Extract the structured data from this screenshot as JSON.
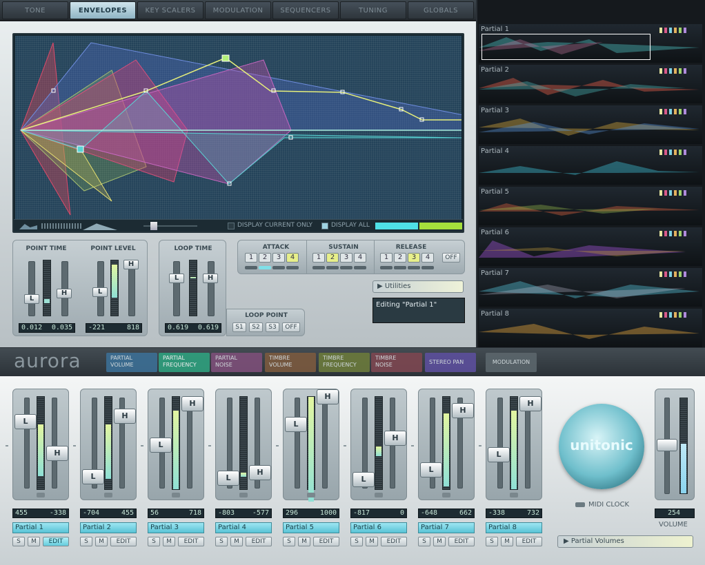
{
  "top_tabs": [
    {
      "label": "TONE",
      "active": false
    },
    {
      "label": "ENVELOPES",
      "active": true
    },
    {
      "label": "KEY SCALERS",
      "active": false
    },
    {
      "label": "MODULATION",
      "active": false
    },
    {
      "label": "SEQUENCERS",
      "active": false
    },
    {
      "label": "TUNING",
      "active": false
    },
    {
      "label": "GLOBALS",
      "active": false
    }
  ],
  "envelope_display": {
    "display_current_only": "DISPLAY CURRENT ONLY",
    "display_all": "DISPLAY ALL"
  },
  "point_controls": {
    "point_time_label": "POINT TIME",
    "point_level_label": "POINT LEVEL",
    "point_time_values": [
      "0.012",
      "0.035"
    ],
    "point_level_values": [
      "-221",
      "818"
    ],
    "loop_time_label": "LOOP TIME",
    "loop_time_values": [
      "0.619",
      "0.619"
    ],
    "knob_low": "L",
    "knob_high": "H"
  },
  "stages": {
    "attack_label": "ATTACK",
    "sustain_label": "SUSTAIN",
    "release_label": "RELEASE",
    "attack": {
      "options": [
        "1",
        "2",
        "3",
        "4"
      ],
      "selected": "4"
    },
    "sustain": {
      "options": [
        "1",
        "2",
        "3",
        "4"
      ],
      "selected": "2"
    },
    "release": {
      "options": [
        "1",
        "2",
        "3",
        "4"
      ],
      "selected": "3"
    },
    "off_label": "OFF"
  },
  "loop_point": {
    "label": "LOOP POINT",
    "options": [
      "S1",
      "S2",
      "S3",
      "OFF"
    ]
  },
  "utilities": {
    "label": "Utilities",
    "editing_text": "Editing \"Partial 1\""
  },
  "partials_panel": [
    {
      "label": "Partial 1"
    },
    {
      "label": "Partial 2"
    },
    {
      "label": "Partial 3"
    },
    {
      "label": "Partial 4"
    },
    {
      "label": "Partial 5"
    },
    {
      "label": "Partial 6"
    },
    {
      "label": "Partial 7"
    },
    {
      "label": "Partial 8"
    }
  ],
  "logo": "aurora",
  "mod_tabs": [
    {
      "line1": "PARTIAL",
      "line2": "VOLUME",
      "color": "#3c6f95"
    },
    {
      "line1": "PARTIAL",
      "line2": "FREQUENCY",
      "color": "#2fa07e"
    },
    {
      "line1": "PARTIAL",
      "line2": "NOISE",
      "color": "#7d4f79"
    },
    {
      "line1": "TIMBRE",
      "line2": "VOLUME",
      "color": "#7b5a3f"
    },
    {
      "line1": "TIMBRE",
      "line2": "FREQUENCY",
      "color": "#6b7a3c"
    },
    {
      "line1": "TIMBRE",
      "line2": "NOISE",
      "color": "#7d4751"
    },
    {
      "line1": "STEREO PAN",
      "line2": "",
      "color": "#5c4f9c"
    }
  ],
  "modulation_button": "MODULATION",
  "mixer": {
    "strips": [
      {
        "name": "Partial 1",
        "low": "455",
        "high": "-338",
        "level": 0.72,
        "edit_on": true
      },
      {
        "name": "Partial 2",
        "low": "-704",
        "high": "455",
        "level": 0.75,
        "edit_on": false
      },
      {
        "name": "Partial 3",
        "low": "56",
        "high": "718",
        "level": 0.86,
        "edit_on": false
      },
      {
        "name": "Partial 4",
        "low": "-803",
        "high": "-577",
        "level": 0.21,
        "edit_on": false
      },
      {
        "name": "Partial 5",
        "low": "296",
        "high": "1000",
        "level": 1.0,
        "edit_on": false
      },
      {
        "name": "Partial 6",
        "low": "-817",
        "high": "0",
        "level": 0.5,
        "edit_on": false
      },
      {
        "name": "Partial 7",
        "low": "-648",
        "high": "662",
        "level": 0.83,
        "edit_on": false
      },
      {
        "name": "Partial 8",
        "low": "-338",
        "high": "732",
        "level": 0.86,
        "edit_on": false
      }
    ],
    "s_label": "S",
    "m_label": "M",
    "edit_label": "EDIT",
    "brand": "unitonic",
    "midi_clock": "MIDI CLOCK",
    "volume_value": "254",
    "volume_label": "VOLUME",
    "partial_volumes": "Partial Volumes"
  }
}
